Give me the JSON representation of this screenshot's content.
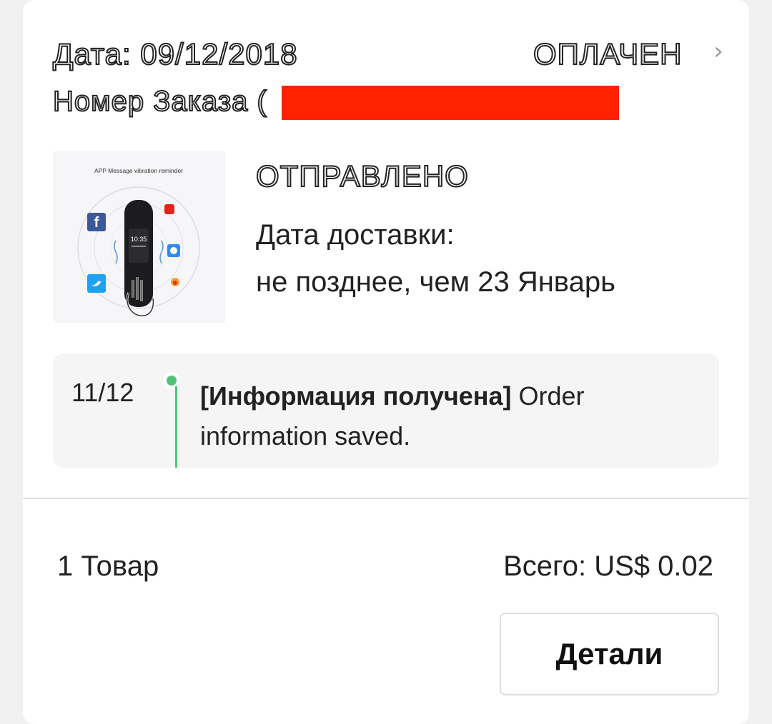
{
  "order": {
    "date_text": "Дата: 09/12/2018",
    "status": "ОПЛАЧЕН",
    "chevron": "chevron-right-icon",
    "number_label": "Номер Заказа (",
    "redaction_color": "#ff2200"
  },
  "product": {
    "image_caption": "APP Message vibration reminder",
    "device_time": "10:35",
    "shipping_status": "ОТПРАВЛЕНО",
    "delivery_label": "Дата доставки:",
    "delivery_value": "не позднее, чем 23 Январь"
  },
  "tracking": {
    "date": "11/12",
    "event_title": "[Информация получена]",
    "event_text": " Order information saved.",
    "dot_color": "#52c27a"
  },
  "summary": {
    "items_count": "1 Товар",
    "total": "Всего: US$ 0.02"
  },
  "actions": {
    "details_label": "Детали"
  }
}
